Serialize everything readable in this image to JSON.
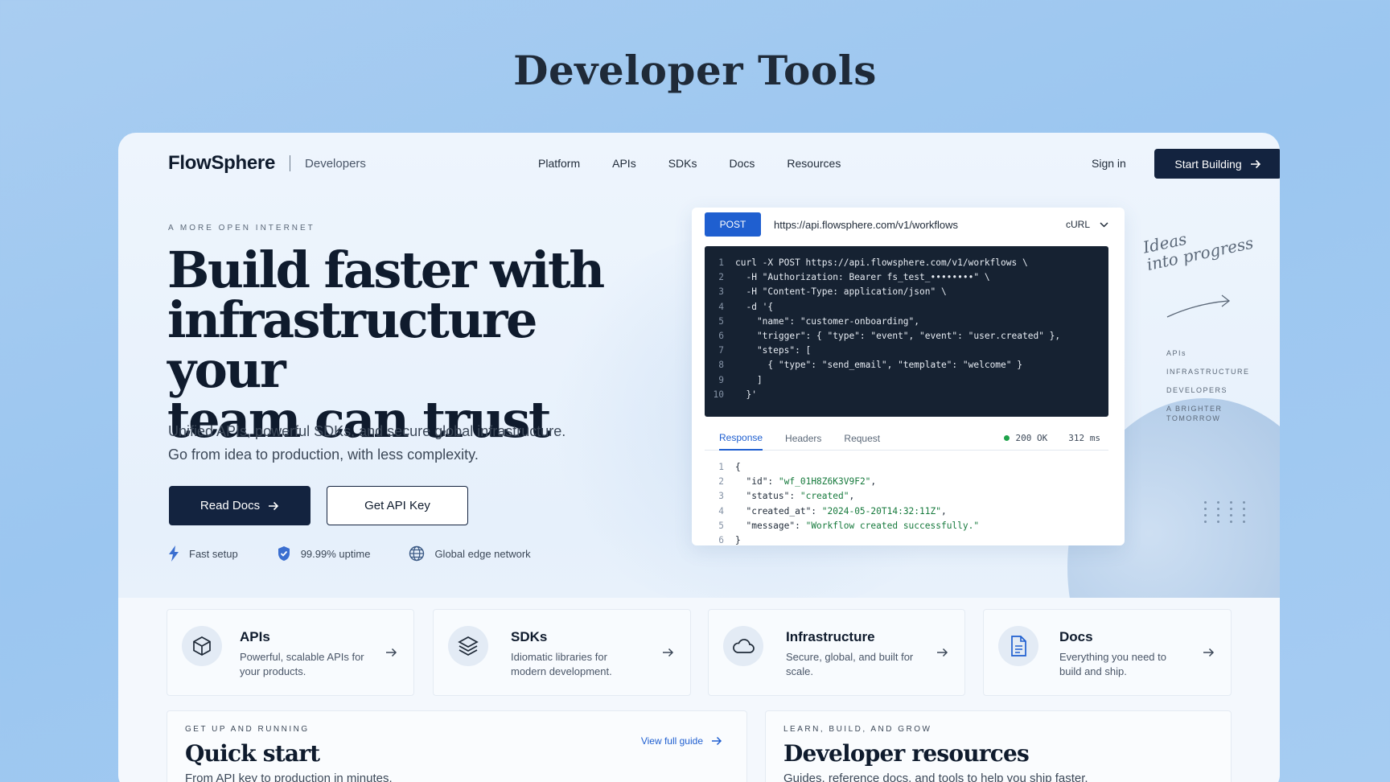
{
  "page_heading": "Developer Tools",
  "nav": {
    "logo": "FlowSphere",
    "logo_sub": "Developers",
    "links": [
      "Platform",
      "APIs",
      "SDKs",
      "Docs",
      "Resources"
    ],
    "signin": "Sign in",
    "cta": "Start Building"
  },
  "hero": {
    "eyebrow": "A MORE OPEN INTERNET",
    "title_line1": "Build faster with",
    "title_line2": "infrastructure your",
    "title_line3": "team can trust",
    "sub_line1": "Unified APIs, powerful SDKs, and secure global infrastructure.",
    "sub_line2": "Go from idea to production, with less complexity.",
    "primary_btn": "Read Docs",
    "secondary_btn": "Get API Key",
    "features": [
      "Fast setup",
      "99.99% uptime",
      "Global edge network"
    ]
  },
  "api_panel": {
    "method": "POST",
    "url": "https://api.flowsphere.com/v1/workflows",
    "language": "cURL",
    "request_lines": [
      "curl -X POST https://api.flowsphere.com/v1/workflows \\",
      "  -H \"Authorization: Bearer fs_test_••••••••\" \\",
      "  -H \"Content-Type: application/json\" \\",
      "  -d '{",
      "    \"name\": \"customer-onboarding\",",
      "    \"trigger\": { \"type\": \"event\", \"event\": \"user.created\" },",
      "    \"steps\": [",
      "      { \"type\": \"send_email\", \"template\": \"welcome\" }",
      "    ]",
      "  }'"
    ],
    "tabs": [
      "Response",
      "Headers",
      "Request"
    ],
    "status": "200 OK",
    "latency": "312 ms",
    "response": {
      "open": "{",
      "close": "}",
      "fields": [
        {
          "key": "\"id\": ",
          "value": "\"wf_01H8Z6K3V9F2\"",
          "tail": ","
        },
        {
          "key": "\"status\": ",
          "value": "\"created\"",
          "tail": ","
        },
        {
          "key": "\"created_at\": ",
          "value": "\"2024-05-20T14:32:11Z\"",
          "tail": ","
        },
        {
          "key": "\"message\": ",
          "value": "\"Workflow created successfully.\"",
          "tail": ""
        }
      ]
    }
  },
  "side": {
    "handwriting_line1": "Ideas",
    "handwriting_line2": "into progress",
    "list": [
      "APIs",
      "INFRASTRUCTURE",
      "DEVELOPERS",
      "A BRIGHTER TOMORROW"
    ]
  },
  "products": [
    {
      "title": "APIs",
      "desc": "Powerful, scalable APIs for your products.",
      "icon": "cube-icon"
    },
    {
      "title": "SDKs",
      "desc": "Idiomatic libraries for modern development.",
      "icon": "layers-icon"
    },
    {
      "title": "Infrastructure",
      "desc": "Secure, global, and built for scale.",
      "icon": "cloud-icon"
    },
    {
      "title": "Docs",
      "desc": "Everything you need to build and ship.",
      "icon": "document-icon"
    }
  ],
  "quickstart": {
    "eyebrow": "GET UP AND RUNNING",
    "title": "Quick start",
    "sub": "From API key to production in minutes.",
    "link": "View full guide"
  },
  "resources": {
    "eyebrow": "LEARN, BUILD, AND GROW",
    "title": "Developer resources",
    "sub": "Guides, reference docs, and tools to help you ship faster."
  },
  "colors": {
    "accent": "#1f5fd0",
    "navy": "#13233f",
    "success": "#1fa34a"
  }
}
